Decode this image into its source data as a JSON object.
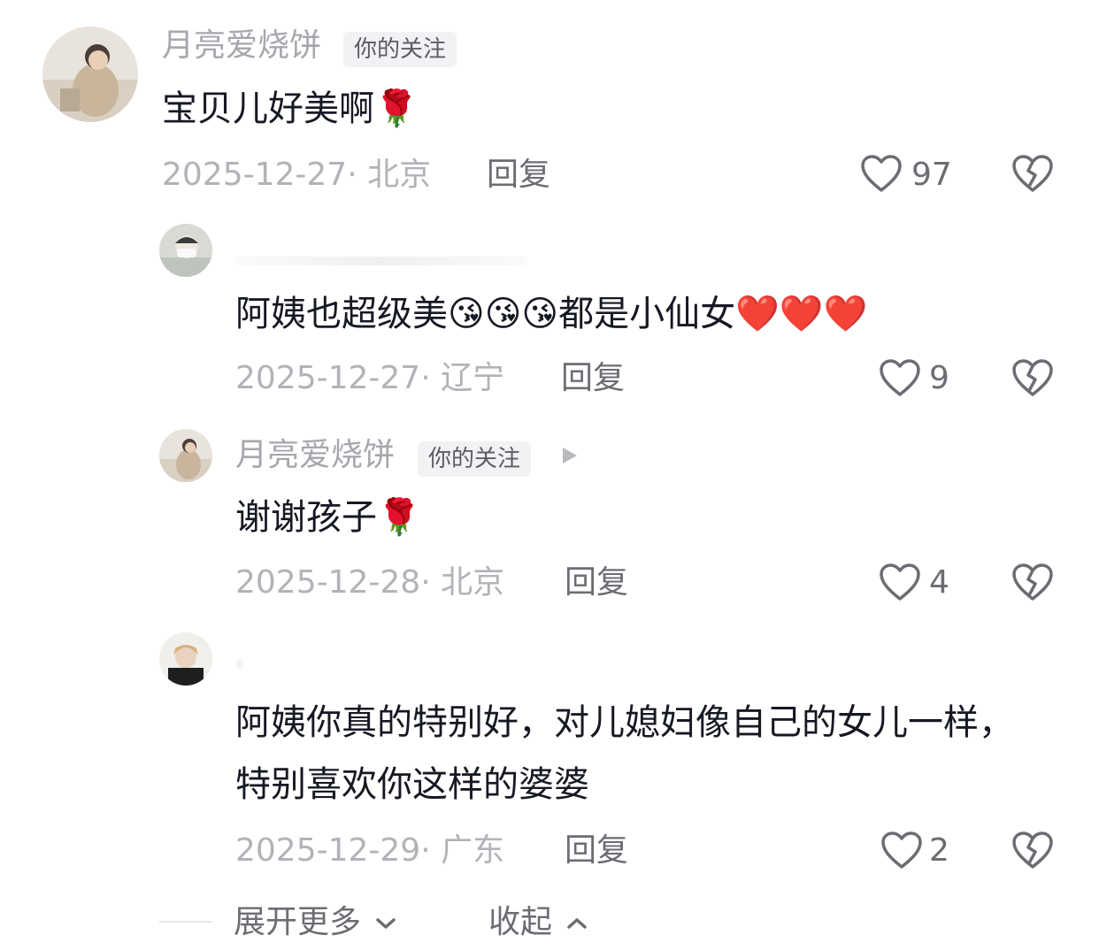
{
  "comments": [
    {
      "username": "月亮爱烧饼",
      "badge": "你的关注",
      "text": "宝贝儿好美啊",
      "emoji": "🌹",
      "date_location": "2025-12-27· 北京",
      "reply_label": "回复",
      "likes": "97"
    },
    {
      "username": "",
      "text_prefix": "阿姨也超级美",
      "emojis_a": "😘😘😘",
      "text_mid": "都是小仙女",
      "emojis_b": "❤️❤️❤️",
      "date_location": "2025-12-27· 辽宁",
      "reply_label": "回复",
      "likes": "9"
    },
    {
      "username": "月亮爱烧饼",
      "badge": "你的关注",
      "text": "谢谢孩子",
      "emoji": "🌹",
      "date_location": "2025-12-28· 北京",
      "reply_label": "回复",
      "likes": "4"
    },
    {
      "username": "",
      "text": "阿姨你真的特别好，对儿媳妇像自己的女儿一样，特别喜欢你这样的婆婆",
      "date_location": "2025-12-29· 广东",
      "reply_label": "回复",
      "likes": "2"
    }
  ],
  "footer": {
    "expand_label": "展开更多",
    "collapse_label": "收起"
  },
  "icons": {
    "like": "heart-outline-icon",
    "dislike": "broken-heart-icon",
    "expand": "chevron-down-icon",
    "collapse": "chevron-up-icon",
    "play": "play-triangle-icon"
  },
  "colors": {
    "text_primary": "#161823",
    "text_secondary": "#a5a7ad",
    "action_gray": "#6b6d73",
    "badge_bg": "#f2f2f4"
  }
}
